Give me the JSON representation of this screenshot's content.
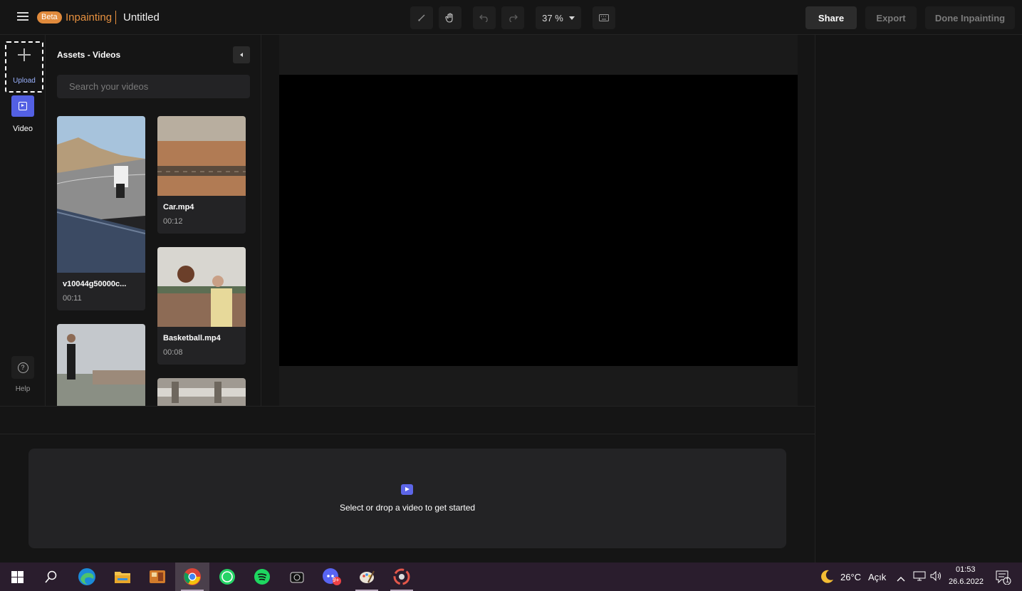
{
  "header": {
    "beta_badge": "Beta",
    "brand": "Inpainting",
    "doc_title": "Untitled",
    "zoom": "37 %",
    "share_label": "Share",
    "export_label": "Export",
    "done_label": "Done Inpainting"
  },
  "rail": {
    "upload_label": "Upload",
    "video_label": "Video",
    "help_label": "Help"
  },
  "assets": {
    "title": "Assets - Videos",
    "search_placeholder": "Search your videos",
    "videos": [
      {
        "name": "v10044g50000c...",
        "duration": "00:11"
      },
      {
        "name": "Car.mp4",
        "duration": "00:12"
      },
      {
        "name": "Basketball.mp4",
        "duration": "00:08"
      }
    ]
  },
  "timeline": {
    "empty_text": "Select or drop a video to get started"
  },
  "taskbar": {
    "weather": "26°C",
    "weather_desc": "Açık",
    "time": "01:53",
    "date": "26.6.2022",
    "discord_badge": "9+",
    "notification_count": "1"
  },
  "colors": {
    "brand": "#e8913f",
    "accent": "#5360e3",
    "background": "#151515"
  }
}
